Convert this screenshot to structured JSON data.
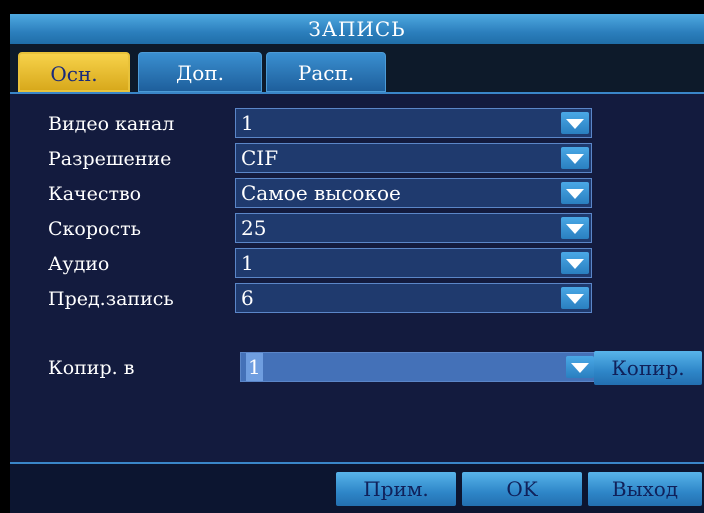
{
  "window": {
    "title": "ЗАПИСЬ"
  },
  "tabs": [
    {
      "label": "Осн.",
      "active": true
    },
    {
      "label": "Доп.",
      "active": false
    },
    {
      "label": "Расп.",
      "active": false
    }
  ],
  "fields": [
    {
      "label": "Видео канал",
      "value": "1"
    },
    {
      "label": "Разрешение",
      "value": "CIF"
    },
    {
      "label": "Качество",
      "value": "Самое высокое"
    },
    {
      "label": "Скорость",
      "value": "25"
    },
    {
      "label": "Аудио",
      "value": "1"
    },
    {
      "label": "Пред.запись",
      "value": "6"
    }
  ],
  "copy": {
    "label": "Копир. в",
    "value": "1",
    "button": "Копир."
  },
  "footer": {
    "apply": "Прим.",
    "ok": "OK",
    "exit": "Выход"
  },
  "icons": {
    "dropdown": "chevron-down-icon"
  }
}
